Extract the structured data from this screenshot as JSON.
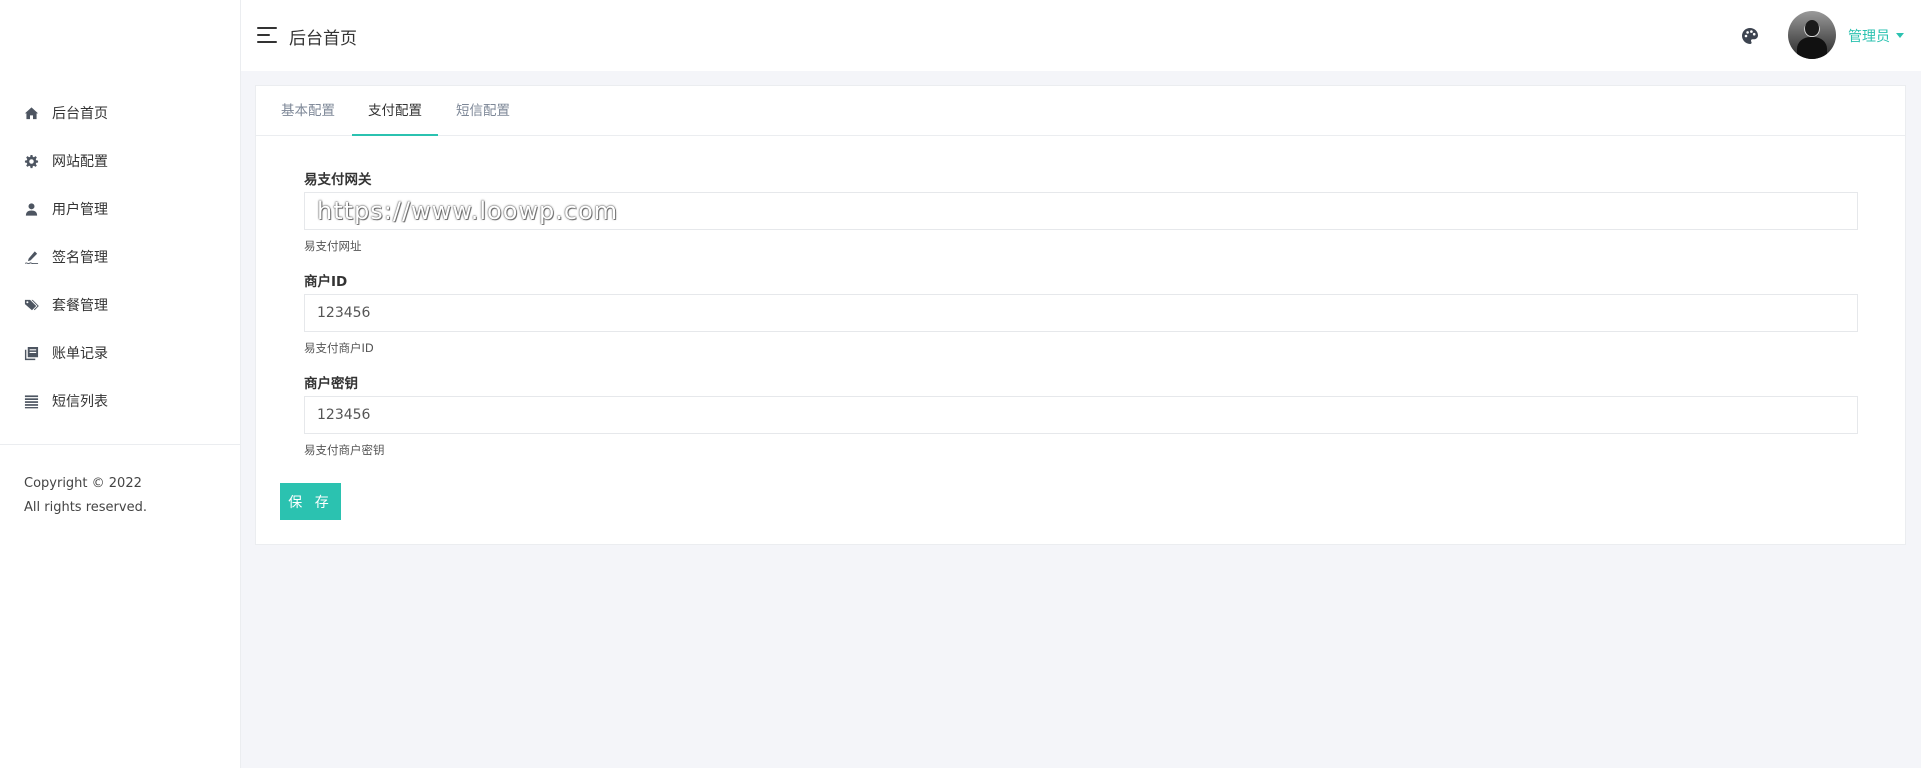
{
  "sidebar": {
    "items": [
      {
        "label": "后台首页",
        "icon": "home-icon"
      },
      {
        "label": "网站配置",
        "icon": "gear-icon"
      },
      {
        "label": "用户管理",
        "icon": "user-icon"
      },
      {
        "label": "签名管理",
        "icon": "signature-icon"
      },
      {
        "label": "套餐管理",
        "icon": "tags-icon"
      },
      {
        "label": "账单记录",
        "icon": "book-icon"
      },
      {
        "label": "短信列表",
        "icon": "list-icon"
      }
    ],
    "copyright_line1": "Copyright © 2022",
    "copyright_line2": "All rights reserved."
  },
  "header": {
    "title": "后台首页",
    "user_name": "管理员"
  },
  "tabs": [
    {
      "label": "基本配置",
      "active": false
    },
    {
      "label": "支付配置",
      "active": true
    },
    {
      "label": "短信配置",
      "active": false
    }
  ],
  "form": {
    "gateway": {
      "label": "易支付网关",
      "value": "https://www.loowp.com",
      "help": "易支付网址"
    },
    "merchant_id": {
      "label": "商户ID",
      "value": "123456",
      "help": "易支付商户ID"
    },
    "merchant_key": {
      "label": "商户密钥",
      "value": "123456",
      "help": "易支付商户密钥"
    },
    "save_label": "保 存"
  },
  "colors": {
    "accent": "#2bc2b0",
    "background": "#f4f5f9",
    "icon": "#4d5561"
  }
}
